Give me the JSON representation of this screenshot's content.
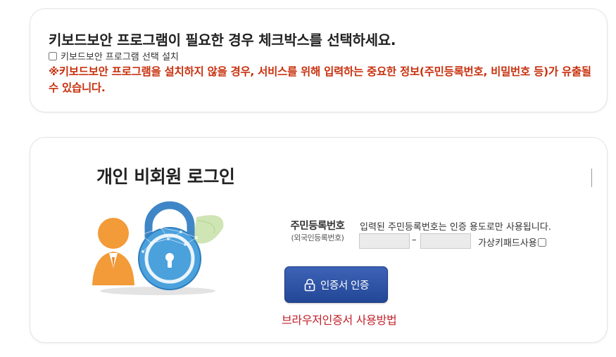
{
  "keyboard_security": {
    "title": "키보드보안 프로그램이 필요한 경우 체크박스를 선택하세요.",
    "checkbox_label": "키보드보안 프로그램 선택 설치",
    "checked": false,
    "warning": "※키보드보안 프로그램을 설치하지 않을 경우, 서비스를 위해 입력하는 중요한 정보(주민등록번호, 비밀번호 등)가 유출될 수 있습니다."
  },
  "login": {
    "title": "개인 비회원 로그인",
    "id_label": "주민등록번호",
    "id_sublabel": "(외국인등록번호)",
    "id_notice": "입력된 주민등록번호는 인증 용도로만 사용됩니다.",
    "id_part1_value": "",
    "id_part2_value": "",
    "separator": "–",
    "virtual_keypad_label": "가상키패드사용",
    "virtual_keypad_checked": false,
    "cert_button_label": "인증서 인증",
    "cert_help_link": "브라우저인증서 사용방법"
  },
  "colors": {
    "warning": "#c8320f",
    "button": "#2d4fa3",
    "link": "#c0202a"
  },
  "icons": [
    "lock-icon",
    "person-lock-illustration"
  ]
}
